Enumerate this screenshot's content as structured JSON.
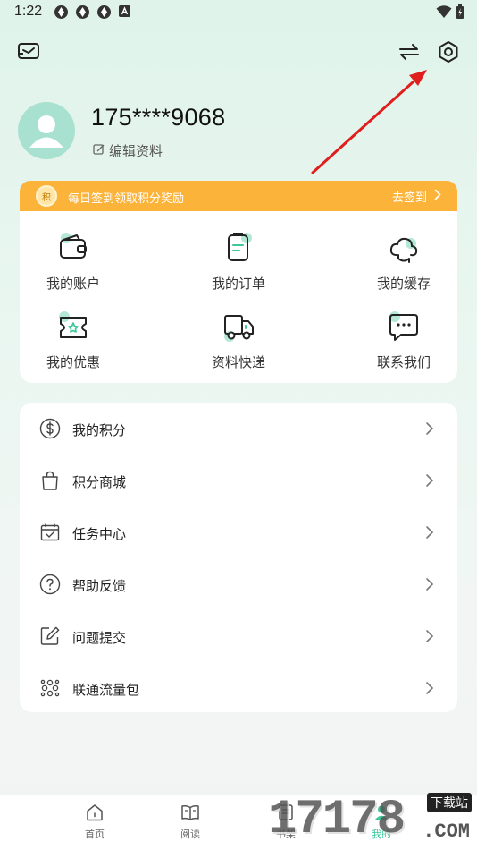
{
  "status": {
    "time": "1:22"
  },
  "profile": {
    "phone": "175****9068",
    "edit_label": "编辑资料"
  },
  "banner": {
    "text": "每日签到领取积分奖励",
    "action": "去签到",
    "coin_char": "积"
  },
  "grid": [
    {
      "label": "我的账户",
      "icon": "wallet-icon"
    },
    {
      "label": "我的订单",
      "icon": "order-icon"
    },
    {
      "label": "我的缓存",
      "icon": "cloud-sync-icon"
    },
    {
      "label": "我的优惠",
      "icon": "coupon-icon"
    },
    {
      "label": "资料快递",
      "icon": "truck-icon"
    },
    {
      "label": "联系我们",
      "icon": "chat-icon"
    }
  ],
  "menu": [
    {
      "label": "我的积分",
      "icon": "dollar-icon"
    },
    {
      "label": "积分商城",
      "icon": "shopping-bag-icon"
    },
    {
      "label": "任务中心",
      "icon": "calendar-check-icon"
    },
    {
      "label": "帮助反馈",
      "icon": "help-icon"
    },
    {
      "label": "问题提交",
      "icon": "edit-icon"
    },
    {
      "label": "联通流量包",
      "icon": "unicom-icon"
    }
  ],
  "tabs": [
    {
      "label": "首页",
      "icon": "home-icon"
    },
    {
      "label": "阅读",
      "icon": "book-icon"
    },
    {
      "label": "书架",
      "icon": "bookshelf-icon"
    },
    {
      "label": "我的",
      "icon": "user-icon"
    }
  ],
  "watermark": {
    "number": "17178",
    "tag": "下载站",
    "domain": ".COM"
  },
  "colors": {
    "accent": "#3cc69a",
    "banner": "#fcb33a",
    "arrow": "#e01e1e"
  }
}
